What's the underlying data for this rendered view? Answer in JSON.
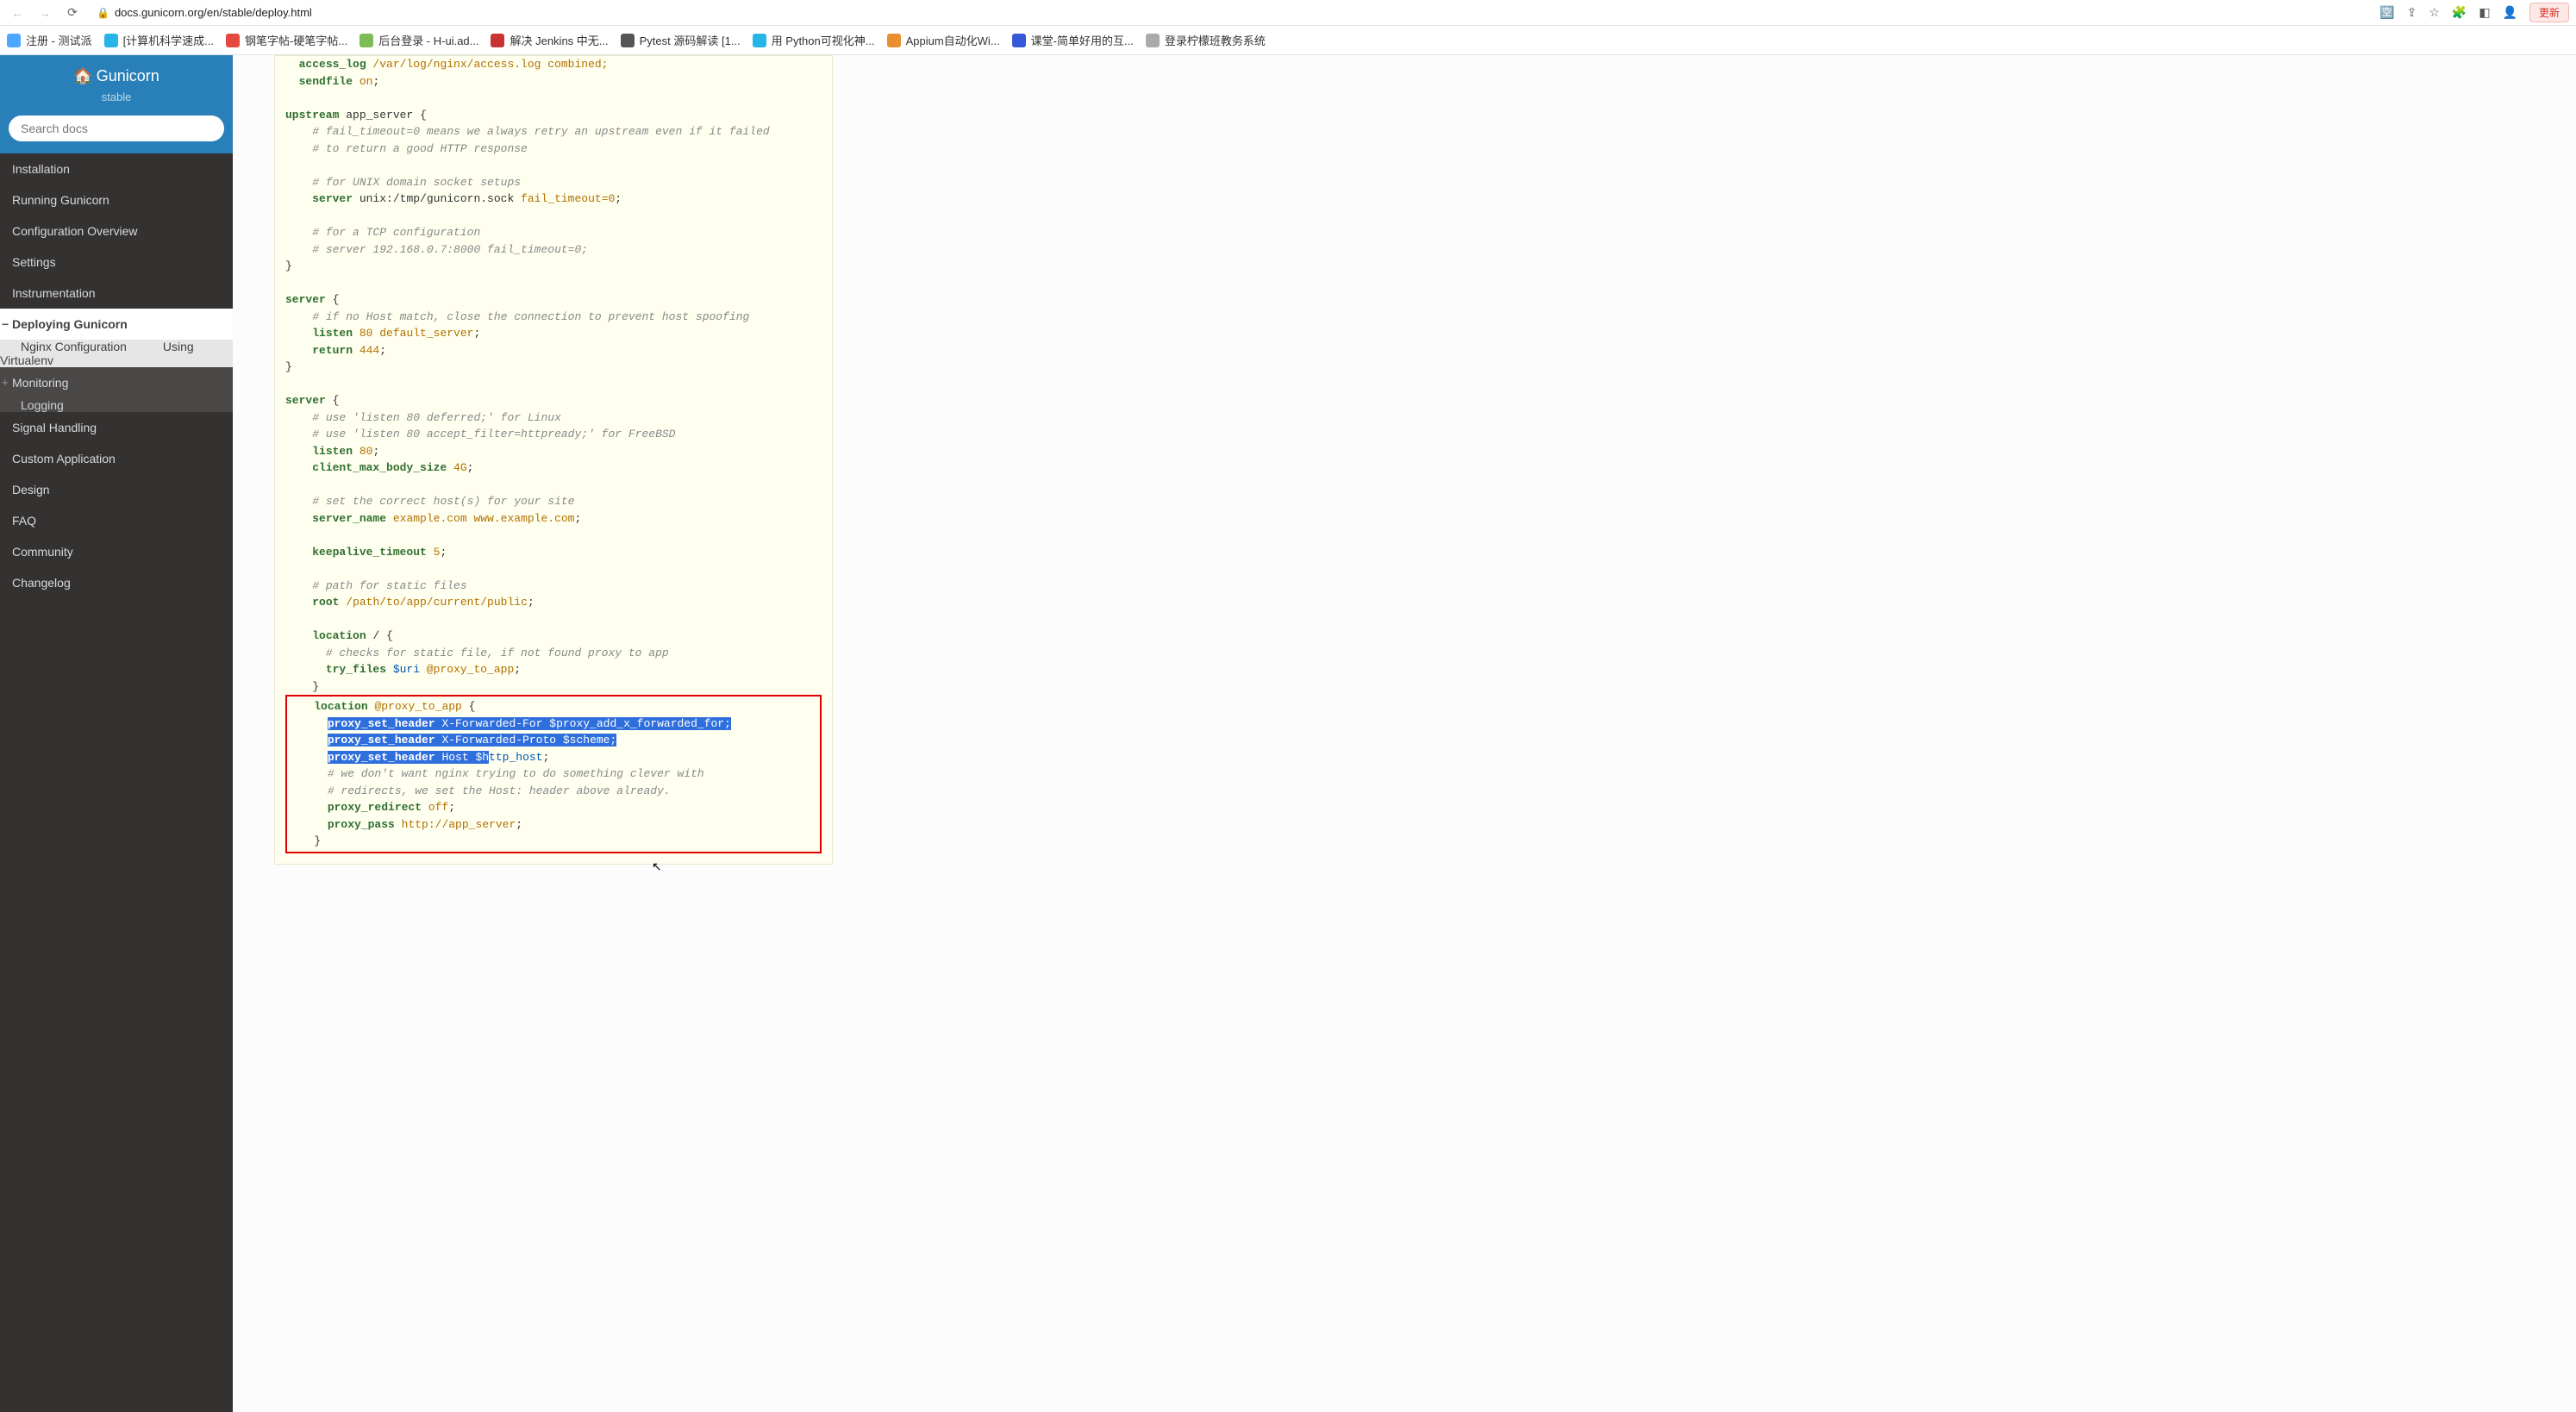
{
  "browser": {
    "url": "docs.gunicorn.org/en/stable/deploy.html",
    "update_label": "更新"
  },
  "bookmarks": [
    {
      "label": "注册 - 测试派",
      "color": "#4da6ff"
    },
    {
      "label": "[计算机科学速成...",
      "color": "#26b5e6"
    },
    {
      "label": "钢笔字帖-硬笔字帖...",
      "color": "#e34a3d"
    },
    {
      "label": "后台登录 - H-ui.ad...",
      "color": "#7dbb55"
    },
    {
      "label": "解决 Jenkins 中无...",
      "color": "#c83434"
    },
    {
      "label": "Pytest 源码解读 [1...",
      "color": "#555"
    },
    {
      "label": "用 Python可视化神...",
      "color": "#26b5e6"
    },
    {
      "label": "Appium自动化Wi...",
      "color": "#e89030"
    },
    {
      "label": "课堂-简单好用的互...",
      "color": "#3558d6"
    },
    {
      "label": "登录柠檬班教务系统",
      "color": "#aaa"
    }
  ],
  "sidebar": {
    "title": "Gunicorn",
    "subtitle": "stable",
    "search_placeholder": "Search docs",
    "nav": [
      {
        "label": "Installation"
      },
      {
        "label": "Running Gunicorn"
      },
      {
        "label": "Configuration Overview"
      },
      {
        "label": "Settings"
      },
      {
        "label": "Instrumentation"
      }
    ],
    "active": {
      "label": "Deploying Gunicorn",
      "children": [
        {
          "label": "Nginx Configuration"
        },
        {
          "label": "Using Virtualenv"
        }
      ]
    },
    "monitoring": {
      "label": "Monitoring",
      "children": [
        {
          "label": "Logging"
        }
      ]
    },
    "rest": [
      {
        "label": "Signal Handling"
      },
      {
        "label": "Custom Application"
      },
      {
        "label": "Design"
      },
      {
        "label": "FAQ"
      },
      {
        "label": "Community"
      },
      {
        "label": "Changelog"
      }
    ]
  },
  "code": {
    "l0a": "access_log",
    "l0b": " /var/log/nginx/access.log combined;",
    "l1a": "sendfile ",
    "l1b": "on",
    "l1c": ";",
    "l2a": "upstream",
    "l2b": " app_server {",
    "l3": "# fail_timeout=0 means we always retry an upstream even if it failed",
    "l4": "# to return a good HTTP response",
    "l5": "# for UNIX domain socket setups",
    "l6a": "server",
    "l6b": " unix:/tmp/gunicorn.sock ",
    "l6c": "fail_timeout=0",
    "l6d": ";",
    "l7": "# for a TCP configuration",
    "l8": "# server 192.168.0.7:8000 fail_timeout=0;",
    "l9": "}",
    "l10a": "server",
    "l10b": " {",
    "l11": "# if no Host match, close the connection to prevent host spoofing",
    "l12a": "listen ",
    "l12b": "80 ",
    "l12c": "default_server",
    "l12d": ";",
    "l13a": "return ",
    "l13b": "444",
    "l13c": ";",
    "l14": "}",
    "l15a": "server",
    "l15b": " {",
    "l16": "# use 'listen 80 deferred;' for Linux",
    "l17": "# use 'listen 80 accept_filter=httpready;' for FreeBSD",
    "l18a": "listen ",
    "l18b": "80",
    "l18c": ";",
    "l19a": "client_max_body_size ",
    "l19b": "4G",
    "l19c": ";",
    "l20": "# set the correct host(s) for your site",
    "l21a": "server_name ",
    "l21b": "example.com www.example.com",
    "l21c": ";",
    "l22a": "keepalive_timeout ",
    "l22b": "5",
    "l22c": ";",
    "l23": "# path for static files",
    "l24a": "root ",
    "l24b": "/path/to/app/current/public",
    "l24c": ";",
    "l25a": "location",
    "l25b": " / {",
    "l26": "# checks for static file, if not found proxy to app",
    "l27a": "try_files ",
    "l27b": "$uri ",
    "l27c": "@proxy_to_app",
    "l27d": ";",
    "l28": "}",
    "r1a": "location ",
    "r1b": "@proxy_to_app",
    "r1c": " {",
    "r2a": "proxy_set_header ",
    "r2b": "X-Forwarded-For ",
    "r2c": "$proxy_add_x_forwarded_for",
    "r2d": ";",
    "r3a": "proxy_set_header ",
    "r3b": "X-Forwarded-Proto ",
    "r3c": "$scheme",
    "r3d": ";",
    "r4a": "proxy_set_header ",
    "r4b": "Host ",
    "r4c": "$h",
    "r4d": "ttp_host",
    "r4e": ";",
    "r5": "# we don't want nginx trying to do something clever with",
    "r6": "# redirects, we set the Host: header above already.",
    "r7a": "proxy_redirect ",
    "r7b": "off",
    "r7c": ";",
    "r8a": "proxy_pass ",
    "r8b": "http://app_server",
    "r8c": ";",
    "r9": "}"
  }
}
